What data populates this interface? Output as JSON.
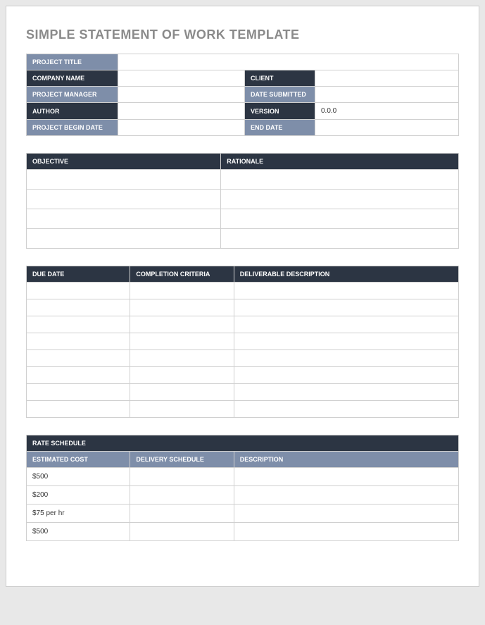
{
  "title": "SIMPLE STATEMENT OF WORK TEMPLATE",
  "meta": {
    "project_title_label": "PROJECT TITLE",
    "project_title_value": "",
    "company_name_label": "COMPANY NAME",
    "company_name_value": "",
    "client_label": "CLIENT",
    "client_value": "",
    "project_manager_label": "PROJECT MANAGER",
    "project_manager_value": "",
    "date_submitted_label": "DATE SUBMITTED",
    "date_submitted_value": "",
    "author_label": "AUTHOR",
    "author_value": "",
    "version_label": "VERSION",
    "version_value": "0.0.0",
    "begin_date_label": "PROJECT BEGIN DATE",
    "begin_date_value": "",
    "end_date_label": "END DATE",
    "end_date_value": ""
  },
  "objective": {
    "objective_label": "OBJECTIVE",
    "rationale_label": "RATIONALE",
    "rows": [
      {
        "objective": "",
        "rationale": ""
      },
      {
        "objective": "",
        "rationale": ""
      },
      {
        "objective": "",
        "rationale": ""
      },
      {
        "objective": "",
        "rationale": ""
      }
    ]
  },
  "deliverables": {
    "due_date_label": "DUE DATE",
    "criteria_label": "COMPLETION CRITERIA",
    "description_label": "DELIVERABLE DESCRIPTION",
    "rows": [
      {
        "due_date": "",
        "criteria": "",
        "description": ""
      },
      {
        "due_date": "",
        "criteria": "",
        "description": ""
      },
      {
        "due_date": "",
        "criteria": "",
        "description": ""
      },
      {
        "due_date": "",
        "criteria": "",
        "description": ""
      },
      {
        "due_date": "",
        "criteria": "",
        "description": ""
      },
      {
        "due_date": "",
        "criteria": "",
        "description": ""
      },
      {
        "due_date": "",
        "criteria": "",
        "description": ""
      },
      {
        "due_date": "",
        "criteria": "",
        "description": ""
      }
    ]
  },
  "rate_schedule": {
    "section_label": "RATE SCHEDULE",
    "estimated_cost_label": "ESTIMATED COST",
    "delivery_schedule_label": "DELIVERY SCHEDULE",
    "description_label": "DESCRIPTION",
    "rows": [
      {
        "cost": "$500",
        "schedule": "",
        "description": ""
      },
      {
        "cost": "$200",
        "schedule": "",
        "description": ""
      },
      {
        "cost": "$75 per hr",
        "schedule": "",
        "description": ""
      },
      {
        "cost": "$500",
        "schedule": "",
        "description": ""
      }
    ]
  }
}
